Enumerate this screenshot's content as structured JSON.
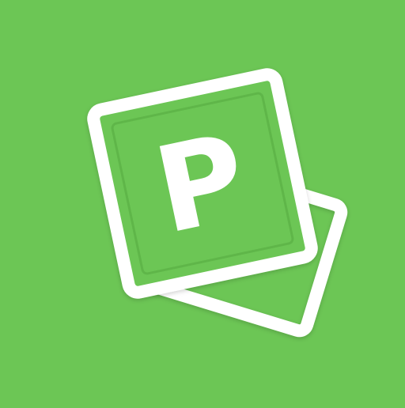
{
  "app_icon": {
    "letter": "P",
    "icon_name": "stacked-cards-icon",
    "colors": {
      "background": "#6cc655",
      "foreground": "#ffffff"
    }
  }
}
